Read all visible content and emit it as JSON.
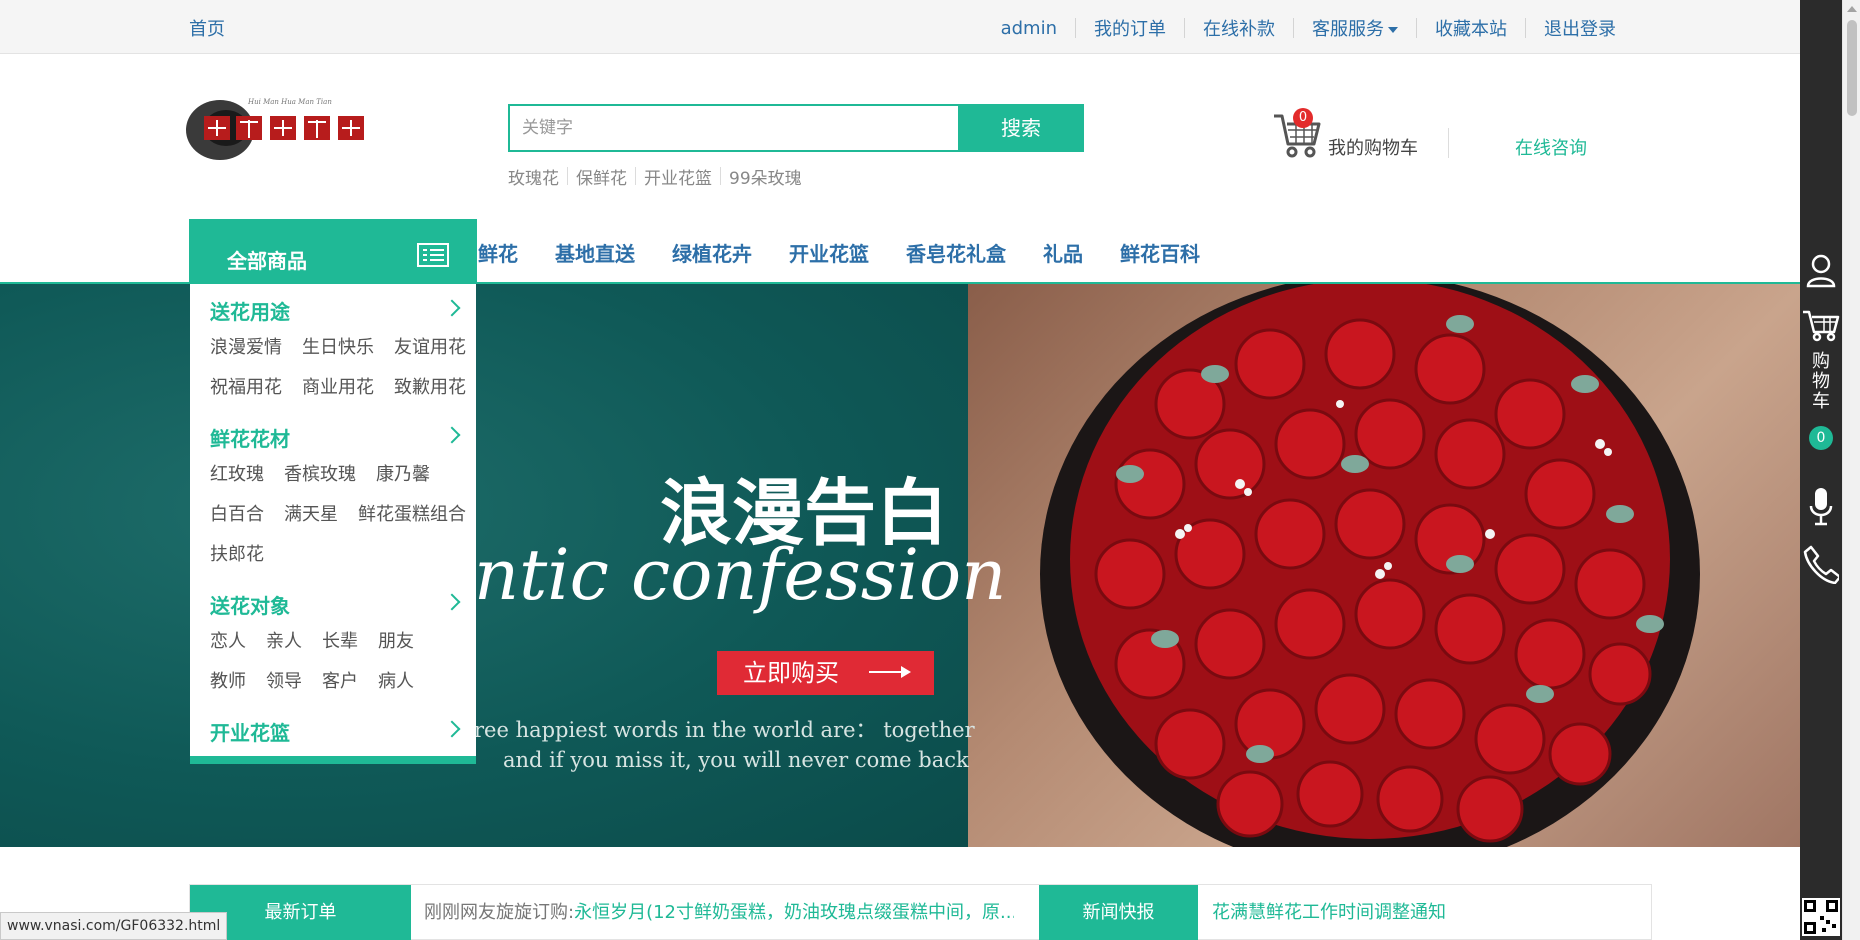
{
  "topbar": {
    "home": "首页",
    "links": [
      "admin",
      "我的订单",
      "在线补款",
      "客服服务",
      "收藏本站",
      "退出登录"
    ]
  },
  "search": {
    "placeholder": "关键字",
    "button": "搜索",
    "hot": [
      "玫瑰花",
      "保鲜花",
      "开业花篮",
      "99朵玫瑰"
    ]
  },
  "cart": {
    "count": "0",
    "label": "我的购物车"
  },
  "consult": "在线咨询",
  "nav": {
    "all_goods": "全部商品",
    "links": [
      "鲜花",
      "基地直送",
      "绿植花卉",
      "开业花篮",
      "香皂花礼盒",
      "礼品",
      "鲜花百科"
    ]
  },
  "categories": [
    {
      "title": "送花用途",
      "rows": [
        [
          "浪漫爱情",
          "生日快乐",
          "友谊用花"
        ],
        [
          "祝福用花",
          "商业用花",
          "致歉用花"
        ]
      ]
    },
    {
      "title": "鲜花花材",
      "rows": [
        [
          "红玫瑰",
          "香槟玫瑰",
          "康乃馨"
        ],
        [
          "白百合",
          "满天星",
          "鲜花蛋糕组合"
        ],
        [
          "扶郎花"
        ]
      ]
    },
    {
      "title": "送花对象",
      "rows": [
        [
          "恋人",
          "亲人",
          "长辈",
          "朋友"
        ],
        [
          "教师",
          "领导",
          "客户",
          "病人"
        ]
      ]
    },
    {
      "title": "开业花篮",
      "rows": []
    }
  ],
  "banner": {
    "title": "浪漫告白",
    "script": "ntic confession",
    "button": "立即购买",
    "quote1": "ree happiest words in the world are： together",
    "quote2": "and if you miss it, you will never come back"
  },
  "strip": {
    "tag1": "最新订单",
    "ticker_prefix": "刚刚网友旋旋订购:",
    "ticker_text": "永恒岁月(12寸鲜奶蛋糕，奶油玫瑰点缀蛋糕中间，原...",
    "tag2": "新闻快报",
    "news": "花满慧鲜花工作时间调整通知"
  },
  "status_url": "www.vnasi.com/GF06332.html",
  "sidebar": {
    "cart_text": "购物车",
    "cart_count": "0"
  },
  "colors": {
    "accent": "#1fb996",
    "link": "#2d6fa8",
    "buy": "#e02a35",
    "banner_bg": "#0f5957"
  }
}
